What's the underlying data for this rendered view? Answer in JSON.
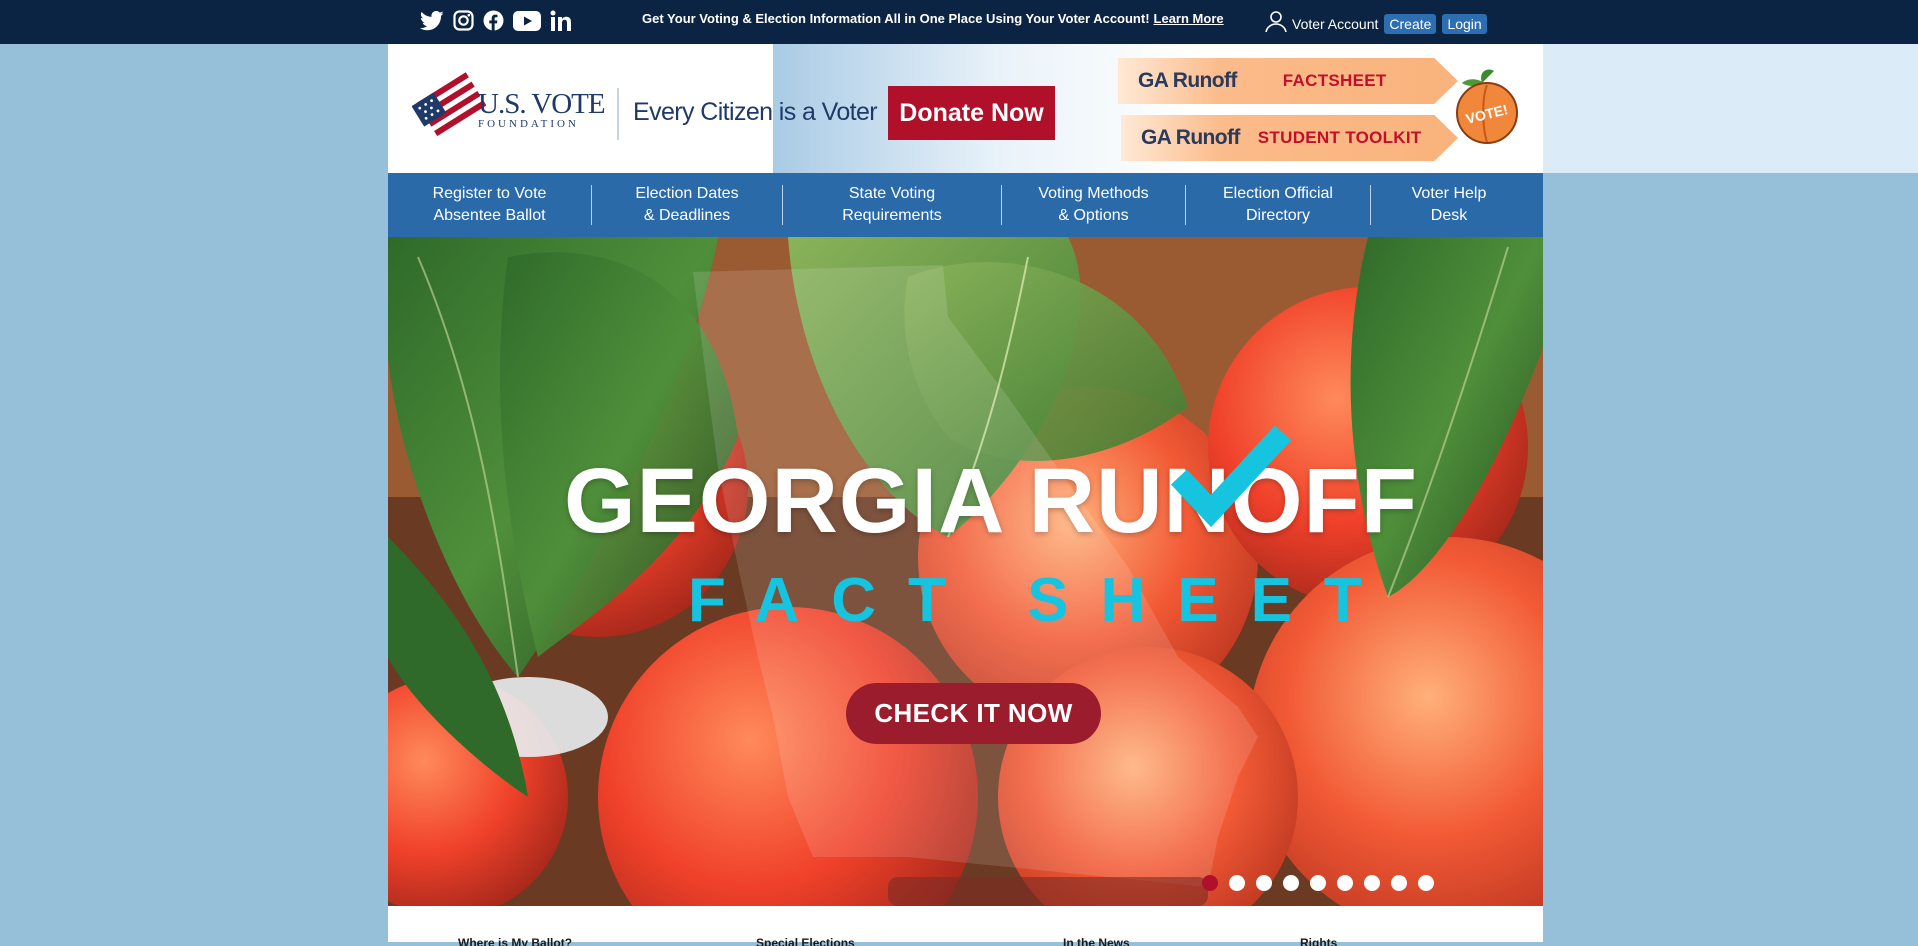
{
  "topbar": {
    "social": [
      "twitter-icon",
      "instagram-icon",
      "facebook-icon",
      "youtube-icon",
      "linkedin-icon"
    ],
    "announcement": "Get Your Voting & Election Information All in One Place Using Your Voter Account!",
    "learn_more": "Learn More",
    "account_label": "Voter Account",
    "create_label": "Create",
    "login_label": "Login"
  },
  "header": {
    "logo_main": "U.S. VOTE",
    "logo_sub": "FOUNDATION",
    "tagline": "Every Citizen is a Voter",
    "donate_label": "Donate Now",
    "runoff_tabs": [
      {
        "left": "GA Runoff",
        "right": "FACTSHEET"
      },
      {
        "left": "GA Runoff",
        "right": "STUDENT TOOLKIT"
      }
    ],
    "badge_text": "VOTE!"
  },
  "nav": {
    "items": [
      {
        "line1": "Register to Vote",
        "line2": "Absentee Ballot"
      },
      {
        "line1": "Election Dates",
        "line2": "& Deadlines"
      },
      {
        "line1": "State Voting",
        "line2": "Requirements"
      },
      {
        "line1": "Voting Methods",
        "line2": "& Options"
      },
      {
        "line1": "Election Official",
        "line2": "Directory"
      },
      {
        "line1": "Voter Help",
        "line2": "Desk"
      }
    ]
  },
  "hero": {
    "title": "GEORGIA RUNOFF",
    "subtitle": "FACT SHEET",
    "cta_label": "CHECK IT NOW",
    "slide_count": 9,
    "active_slide": 1
  },
  "peek": {
    "items": [
      "Where is My Ballot?",
      "Special Elections",
      "In the News",
      "Rights"
    ]
  },
  "colors": {
    "topbar": "#0b2443",
    "nav": "#2a6aa9",
    "donate": "#b0102a",
    "accent_cyan": "#16c4e0",
    "page_bg": "#96bfda"
  }
}
